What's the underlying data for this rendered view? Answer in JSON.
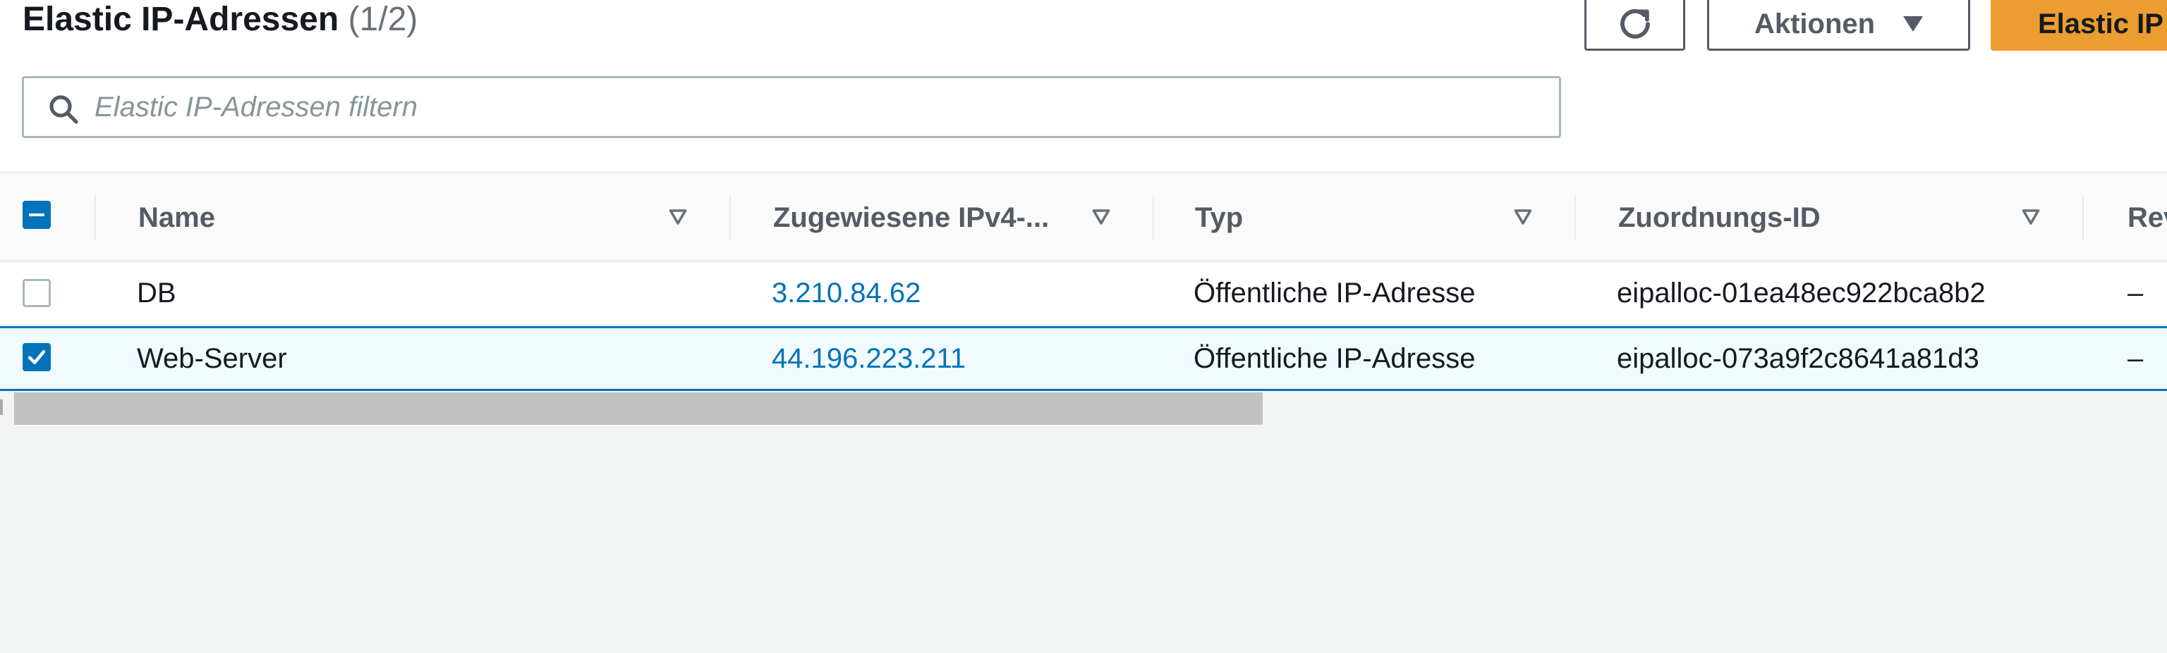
{
  "page": {
    "title": "Elastic IP-Adressen",
    "count": "(1/2)"
  },
  "toolbar": {
    "refresh_icon": "refresh-icon",
    "actions_label": "Aktionen",
    "primary_label": "Elastic IP"
  },
  "search": {
    "placeholder": "Elastic IP-Adressen filtern",
    "value": ""
  },
  "table": {
    "columns": [
      "Name",
      "Zugewiesene IPv4-...",
      "Typ",
      "Zuordnungs-ID",
      "Rev"
    ],
    "rows": [
      {
        "selected": false,
        "name": "DB",
        "ip": "3.210.84.62",
        "type": "Öffentliche IP-Adresse",
        "allocation_id": "eipalloc-01ea48ec922bca8b2",
        "rev": "–"
      },
      {
        "selected": true,
        "name": "Web-Server",
        "ip": "44.196.223.211",
        "type": "Öffentliche IP-Adresse",
        "allocation_id": "eipalloc-073a9f2c8641a81d3",
        "rev": "–"
      }
    ]
  },
  "colors": {
    "primary": "#ec9d30",
    "link": "#0073bb",
    "checkbox": "#0073bb"
  }
}
